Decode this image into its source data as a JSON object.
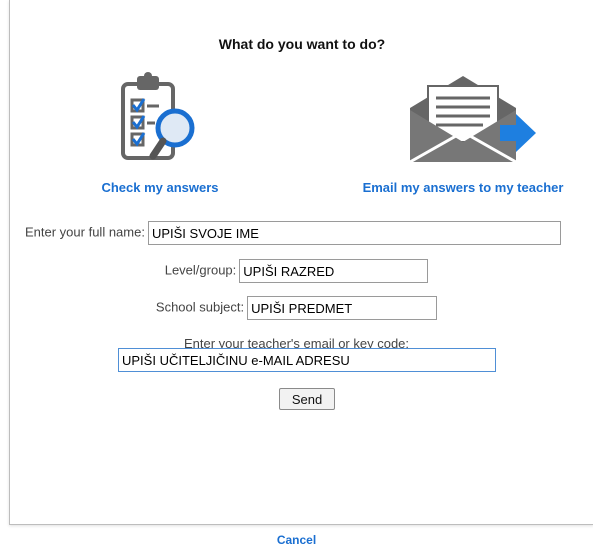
{
  "dialog": {
    "title": "What do you want to do?",
    "options": [
      {
        "label": "Check my answers",
        "icon": "clipboard-checklist-magnifier-icon"
      },
      {
        "label": "Email my answers to my teacher",
        "icon": "envelope-send-arrow-icon"
      }
    ]
  },
  "form": {
    "full_name": {
      "label": "Enter your full name:",
      "value": "UPIŠI SVOJE IME"
    },
    "level": {
      "label": "Level/group:",
      "value": "UPIŠI RAZRED"
    },
    "subject": {
      "label": "School subject:",
      "value": "UPIŠI PREDMET"
    },
    "teacher": {
      "label": "Enter your teacher's email or key code:",
      "value": "UPIŠI UČITELJIČINU e-MAIL ADRESU"
    },
    "send_label": "Send"
  },
  "cancel_label": "Cancel",
  "colors": {
    "accent": "#1a6fd1",
    "icon_gray": "#666666",
    "arrow_blue": "#1e7fe0"
  }
}
